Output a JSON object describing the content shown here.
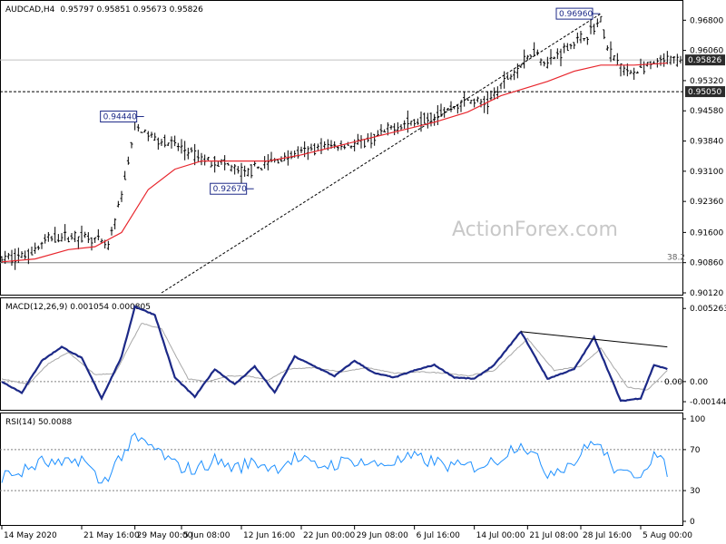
{
  "chart_data": {
    "type": "candlestick",
    "price_panel": {
      "header": {
        "symbol": "AUDCAD,H4",
        "ohlc": "0.95797 0.95851 0.95673 0.95826"
      },
      "y_ticks": [
        "0.96800",
        "0.96060",
        "0.95320",
        "0.94580",
        "0.93840",
        "0.93100",
        "0.92360",
        "0.91600",
        "0.90860",
        "0.90120"
      ],
      "ylim": [
        0.9012,
        0.9694
      ],
      "highlight_levels": [
        {
          "label": "0.95826",
          "value": 0.95826
        },
        {
          "label": "0.95050",
          "value": 0.9505
        }
      ],
      "annotations": [
        {
          "label": "0.94440",
          "value": 0.9444,
          "x": 40
        },
        {
          "label": "0.92670",
          "value": 0.9267,
          "x": 73
        },
        {
          "label": "0.96960",
          "value": 0.9696,
          "x": 177
        },
        {
          "label": "38.2",
          "value": 0.9086,
          "x": 200
        }
      ],
      "path": [
        [
          0,
          0.9095
        ],
        [
          8,
          0.9105
        ],
        [
          14,
          0.9145
        ],
        [
          20,
          0.915
        ],
        [
          26,
          0.915
        ],
        [
          32,
          0.9125
        ],
        [
          36,
          0.925
        ],
        [
          40,
          0.942
        ],
        [
          46,
          0.939
        ],
        [
          52,
          0.9375
        ],
        [
          60,
          0.934
        ],
        [
          66,
          0.933
        ],
        [
          73,
          0.9305
        ],
        [
          80,
          0.933
        ],
        [
          88,
          0.935
        ],
        [
          96,
          0.937
        ],
        [
          104,
          0.9375
        ],
        [
          110,
          0.938
        ],
        [
          118,
          0.942
        ],
        [
          126,
          0.9435
        ],
        [
          134,
          0.946
        ],
        [
          140,
          0.9485
        ],
        [
          146,
          0.9475
        ],
        [
          150,
          0.952
        ],
        [
          154,
          0.9555
        ],
        [
          160,
          0.9605
        ],
        [
          164,
          0.9575
        ],
        [
          170,
          0.9615
        ],
        [
          176,
          0.9645
        ],
        [
          180,
          0.968
        ],
        [
          182,
          0.961
        ],
        [
          188,
          0.955
        ],
        [
          194,
          0.9565
        ],
        [
          200,
          0.9583
        ]
      ],
      "ma_path": [
        [
          0,
          0.9088
        ],
        [
          10,
          0.9095
        ],
        [
          20,
          0.9118
        ],
        [
          28,
          0.9125
        ],
        [
          36,
          0.916
        ],
        [
          44,
          0.9265
        ],
        [
          52,
          0.9315
        ],
        [
          60,
          0.9335
        ],
        [
          70,
          0.9335
        ],
        [
          80,
          0.9335
        ],
        [
          90,
          0.935
        ],
        [
          100,
          0.937
        ],
        [
          110,
          0.939
        ],
        [
          120,
          0.941
        ],
        [
          130,
          0.943
        ],
        [
          140,
          0.9455
        ],
        [
          150,
          0.9495
        ],
        [
          156,
          0.951
        ],
        [
          164,
          0.953
        ],
        [
          172,
          0.9555
        ],
        [
          180,
          0.957
        ],
        [
          190,
          0.957
        ],
        [
          200,
          0.9575
        ]
      ],
      "trendline": [
        [
          48,
          0.9012
        ],
        [
          180,
          0.9696
        ]
      ]
    },
    "macd_panel": {
      "header": "MACD(12,26,9) 0.001054 0.000805",
      "y_ticks": [
        "0.005263",
        "0.00",
        "-0.001447"
      ],
      "ylim": [
        -0.0019,
        0.0058
      ],
      "zero_label": "0.00",
      "macd": [
        [
          0,
          0.0
        ],
        [
          6,
          -0.0008
        ],
        [
          12,
          0.0015
        ],
        [
          18,
          0.0025
        ],
        [
          24,
          0.0017
        ],
        [
          30,
          -0.0012
        ],
        [
          36,
          0.0018
        ],
        [
          40,
          0.0054
        ],
        [
          46,
          0.0048
        ],
        [
          52,
          0.0003
        ],
        [
          58,
          -0.0011
        ],
        [
          64,
          0.0009
        ],
        [
          70,
          -0.0002
        ],
        [
          76,
          0.0011
        ],
        [
          82,
          -0.0008
        ],
        [
          88,
          0.0018
        ],
        [
          94,
          0.0011
        ],
        [
          100,
          0.0004
        ],
        [
          106,
          0.0015
        ],
        [
          112,
          0.0006
        ],
        [
          118,
          0.0003
        ],
        [
          124,
          0.0008
        ],
        [
          130,
          0.0012
        ],
        [
          136,
          0.0003
        ],
        [
          142,
          0.0002
        ],
        [
          148,
          0.0012
        ],
        [
          156,
          0.0036
        ],
        [
          164,
          0.0002
        ],
        [
          172,
          0.0009
        ],
        [
          178,
          0.0032
        ],
        [
          186,
          -0.0014
        ],
        [
          192,
          -0.0012
        ],
        [
          196,
          0.0012
        ],
        [
          200,
          0.0009
        ]
      ],
      "signal": [
        [
          0,
          0.0002
        ],
        [
          8,
          -0.0002
        ],
        [
          14,
          0.0013
        ],
        [
          20,
          0.0021
        ],
        [
          28,
          0.0005
        ],
        [
          34,
          0.0006
        ],
        [
          42,
          0.0042
        ],
        [
          48,
          0.0038
        ],
        [
          56,
          0.0002
        ],
        [
          62,
          0.0
        ],
        [
          68,
          0.0004
        ],
        [
          74,
          0.0004
        ],
        [
          80,
          0.0001
        ],
        [
          86,
          0.0009
        ],
        [
          94,
          0.001
        ],
        [
          102,
          0.0007
        ],
        [
          110,
          0.001
        ],
        [
          118,
          0.0006
        ],
        [
          126,
          0.0007
        ],
        [
          134,
          0.0006
        ],
        [
          140,
          0.0004
        ],
        [
          148,
          0.0008
        ],
        [
          158,
          0.0031
        ],
        [
          166,
          0.0008
        ],
        [
          174,
          0.0011
        ],
        [
          180,
          0.0024
        ],
        [
          188,
          -0.0004
        ],
        [
          194,
          -0.0006
        ],
        [
          200,
          0.0008
        ]
      ],
      "divergence_line": [
        [
          156,
          0.0036
        ],
        [
          200,
          0.0025
        ]
      ]
    },
    "rsi_panel": {
      "header": "RSI(14) 50.0088",
      "y_ticks": [
        "100",
        "70",
        "30",
        "0"
      ],
      "ylim": [
        0,
        100
      ],
      "levels": [
        70,
        30
      ],
      "values": [
        [
          0,
          44
        ],
        [
          6,
          48
        ],
        [
          12,
          58
        ],
        [
          18,
          54
        ],
        [
          24,
          62
        ],
        [
          30,
          36
        ],
        [
          36,
          65
        ],
        [
          40,
          80
        ],
        [
          46,
          71
        ],
        [
          52,
          55
        ],
        [
          58,
          50
        ],
        [
          64,
          60
        ],
        [
          70,
          52
        ],
        [
          76,
          58
        ],
        [
          82,
          52
        ],
        [
          88,
          62
        ],
        [
          94,
          54
        ],
        [
          100,
          56
        ],
        [
          106,
          60
        ],
        [
          112,
          55
        ],
        [
          118,
          58
        ],
        [
          124,
          62
        ],
        [
          130,
          58
        ],
        [
          136,
          53
        ],
        [
          142,
          54
        ],
        [
          148,
          58
        ],
        [
          156,
          78
        ],
        [
          164,
          48
        ],
        [
          172,
          58
        ],
        [
          178,
          80
        ],
        [
          186,
          44
        ],
        [
          192,
          48
        ],
        [
          196,
          66
        ],
        [
          200,
          50
        ]
      ]
    },
    "x_labels": [
      {
        "label": "14 May 2020",
        "x": 0
      },
      {
        "label": "21 May 16:00",
        "x": 24
      },
      {
        "label": "29 May 00:00",
        "x": 40
      },
      {
        "label": "5 Jun 08:00",
        "x": 54
      },
      {
        "label": "12 Jun 16:00",
        "x": 72
      },
      {
        "label": "22 Jun 00:00",
        "x": 90
      },
      {
        "label": "29 Jun 08:00",
        "x": 106
      },
      {
        "label": "6 Jul 16:00",
        "x": 124
      },
      {
        "label": "14 Jul 00:00",
        "x": 142
      },
      {
        "label": "21 Jul 08:00",
        "x": 158
      },
      {
        "label": "28 Jul 16:00",
        "x": 174
      },
      {
        "label": "5 Aug 00:00",
        "x": 192
      }
    ],
    "x_domain": [
      0,
      204
    ],
    "watermark": "ActionForex.com",
    "colors": {
      "candle": "#000000",
      "ma": "#e8262d",
      "macd": "#1c2987",
      "signal": "#a8a8a8",
      "rsi": "#1e90ff",
      "grid": "#808080"
    }
  }
}
